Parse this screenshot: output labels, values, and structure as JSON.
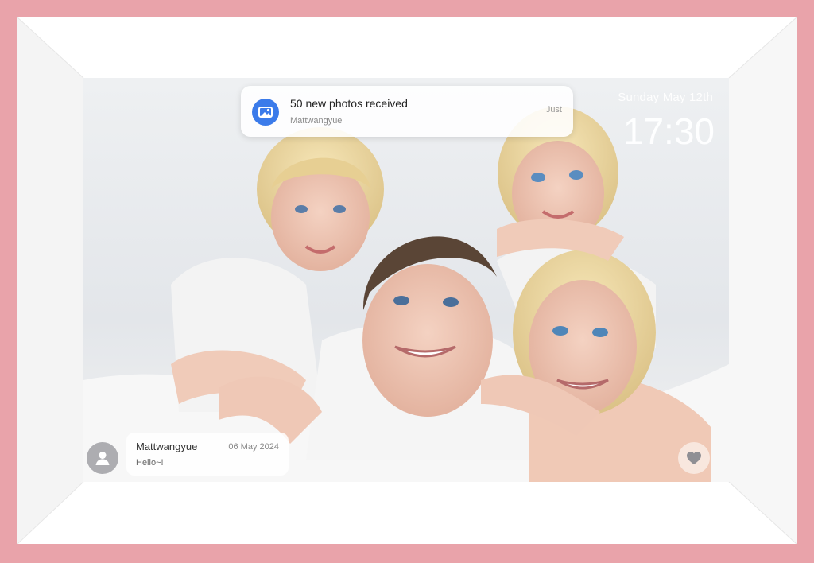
{
  "notification": {
    "title": "50 new photos received",
    "sender": "Mattwangyue",
    "time": "Just",
    "icon": "image-icon"
  },
  "clock": {
    "date": "Sunday May 12th",
    "time": "17:30"
  },
  "message": {
    "name": "Mattwangyue",
    "date": "06 May 2024",
    "text": "Hello~!",
    "avatar_icon": "user-icon"
  },
  "actions": {
    "favorite_icon": "heart-icon"
  },
  "colors": {
    "frame": "#e9a3aa",
    "accent": "#3b7bea"
  }
}
